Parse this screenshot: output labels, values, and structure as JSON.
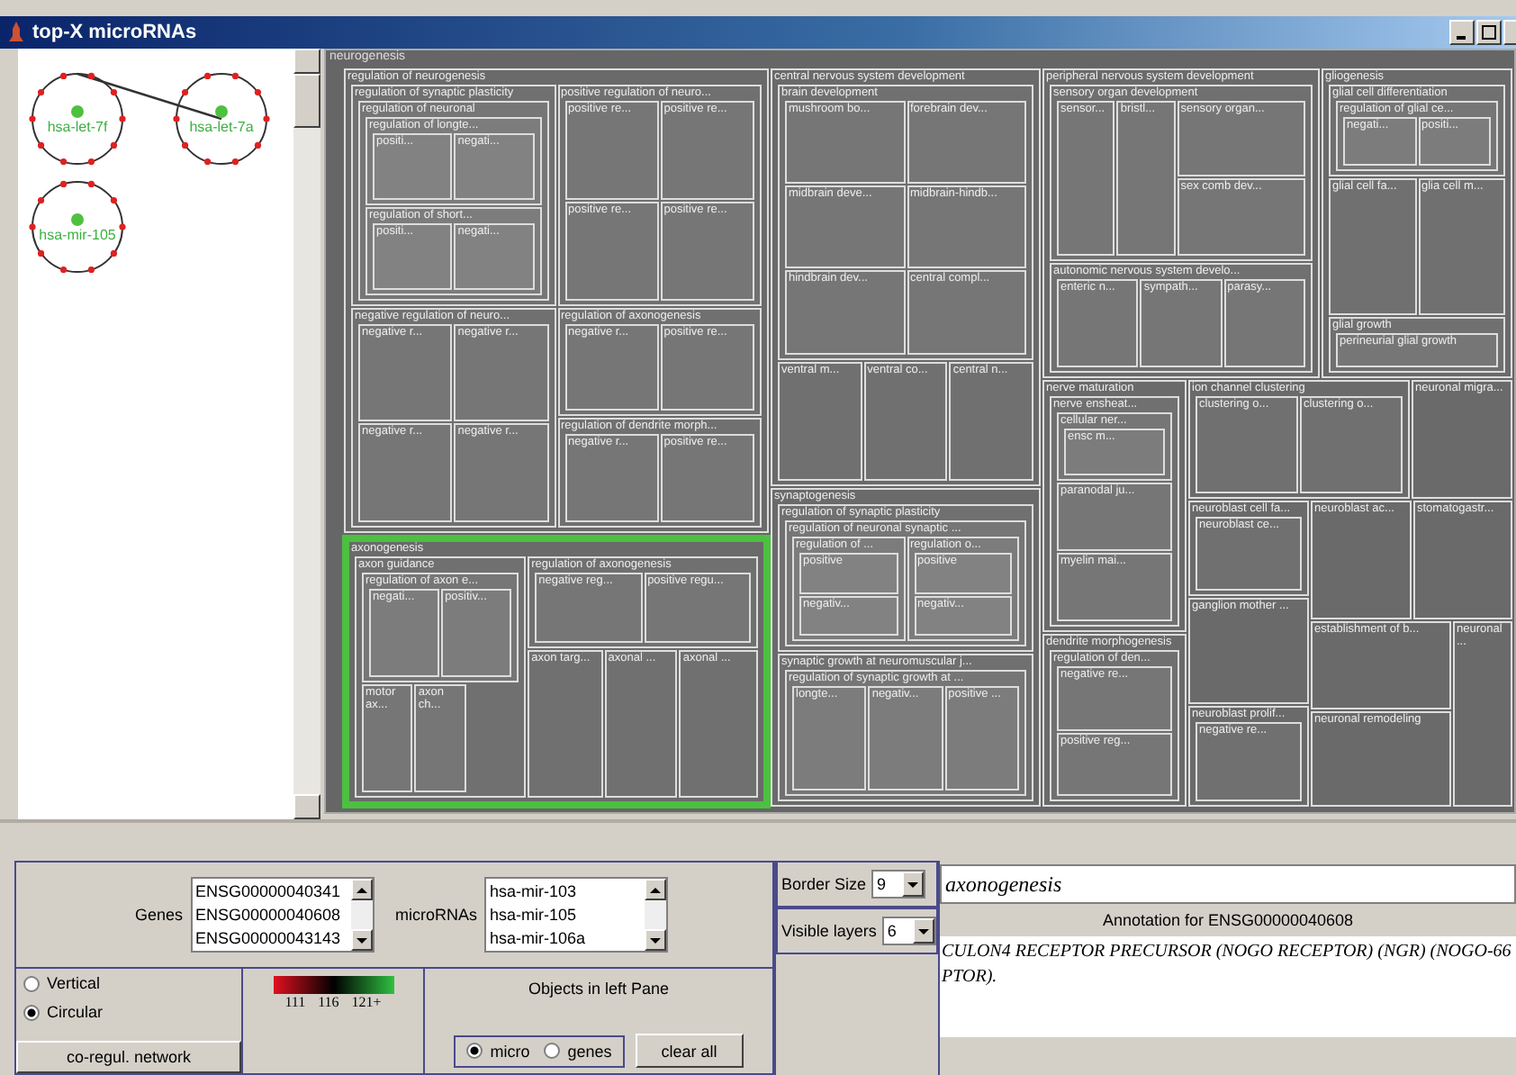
{
  "window": {
    "title": "top-X microRNAs"
  },
  "network": {
    "nodes": [
      {
        "label": "hsa-let-7f"
      },
      {
        "label": "hsa-let-7a"
      },
      {
        "label": "hsa-mir-105"
      }
    ]
  },
  "treemap": {
    "label": "neurogenesis",
    "children": [
      {
        "label": "regulation of neurogenesis",
        "selected": false,
        "children": [
          {
            "label": "regulation of synaptic plasticity",
            "children": [
              {
                "label": "regulation of neuronal",
                "children": [
                  {
                    "label": "regulation of longte...",
                    "children": [
                      {
                        "label": "positi..."
                      },
                      {
                        "label": "negati..."
                      }
                    ]
                  },
                  {
                    "label": "regulation of short...",
                    "children": [
                      {
                        "label": "positi..."
                      },
                      {
                        "label": "negati..."
                      }
                    ]
                  }
                ]
              }
            ]
          },
          {
            "label": "positive regulation of neuro...",
            "children": [
              {
                "label": "positive re..."
              },
              {
                "label": "positive re..."
              },
              {
                "label": "positive re..."
              },
              {
                "label": "positive re..."
              }
            ]
          },
          {
            "label": "negative regulation of neuro...",
            "children": [
              {
                "label": "negative r..."
              },
              {
                "label": "negative r..."
              },
              {
                "label": "negative r..."
              },
              {
                "label": "negative r..."
              }
            ]
          },
          {
            "label": "regulation of axonogenesis",
            "children": [
              {
                "label": "negative r..."
              },
              {
                "label": "positive re..."
              }
            ]
          },
          {
            "label": "regulation of dendrite morph...",
            "children": [
              {
                "label": "negative r..."
              },
              {
                "label": "positive re..."
              }
            ]
          }
        ]
      },
      {
        "label": "central nervous system development",
        "selected": false,
        "children": [
          {
            "label": "brain development",
            "children": [
              {
                "label": "mushroom bo..."
              },
              {
                "label": "forebrain dev..."
              },
              {
                "label": "midbrain deve..."
              },
              {
                "label": "midbrain-hindb..."
              },
              {
                "label": "hindbrain dev..."
              },
              {
                "label": "central compl..."
              }
            ]
          },
          {
            "label": "ventral m..."
          },
          {
            "label": "ventral co..."
          },
          {
            "label": "central n..."
          }
        ]
      },
      {
        "label": "peripheral nervous system development",
        "selected": false,
        "children": [
          {
            "label": "sensory organ development",
            "children": [
              {
                "label": "sensor..."
              },
              {
                "label": "bristl..."
              },
              {
                "label": "sensory organ..."
              },
              {
                "label": "sex comb dev..."
              }
            ]
          },
          {
            "label": "autonomic nervous system develo...",
            "children": [
              {
                "label": "enteric n..."
              },
              {
                "label": "sympath..."
              },
              {
                "label": "parasy..."
              }
            ]
          }
        ]
      },
      {
        "label": "gliogenesis",
        "selected": false,
        "children": [
          {
            "label": "glial cell differentiation",
            "children": [
              {
                "label": "regulation of glial ce...",
                "children": [
                  {
                    "label": "negati..."
                  },
                  {
                    "label": "positi..."
                  }
                ]
              }
            ]
          },
          {
            "label": "glial cell fa..."
          },
          {
            "label": "glia cell m..."
          },
          {
            "label": "glial growth",
            "children": [
              {
                "label": "perineurial glial growth"
              }
            ]
          }
        ]
      },
      {
        "label": "synaptogenesis",
        "selected": false,
        "children": [
          {
            "label": "regulation of synaptic plasticity",
            "children": [
              {
                "label": "regulation of neuronal synaptic ...",
                "children": [
                  {
                    "label": "regulation of ...",
                    "children": [
                      {
                        "label": "positive"
                      },
                      {
                        "label": "negativ..."
                      }
                    ]
                  },
                  {
                    "label": "regulation o...",
                    "children": [
                      {
                        "label": "positive"
                      },
                      {
                        "label": "negativ..."
                      }
                    ]
                  }
                ]
              }
            ]
          },
          {
            "label": "synaptic growth at neuromuscular j...",
            "children": [
              {
                "label": "regulation of synaptic growth at ...",
                "children": [
                  {
                    "label": "longte..."
                  },
                  {
                    "label": "negativ..."
                  },
                  {
                    "label": "positive ..."
                  }
                ]
              }
            ]
          }
        ]
      },
      {
        "label": "axonogenesis",
        "selected": true,
        "children": [
          {
            "label": "axon guidance",
            "children": [
              {
                "label": "regulation of axon e...",
                "children": [
                  {
                    "label": "negati..."
                  },
                  {
                    "label": "positiv..."
                  }
                ]
              },
              {
                "label": "motor ax..."
              },
              {
                "label": "axon ch..."
              }
            ]
          },
          {
            "label": "regulation of axonogenesis",
            "children": [
              {
                "label": "negative reg..."
              },
              {
                "label": "positive regu..."
              }
            ]
          },
          {
            "label": "axon targ..."
          },
          {
            "label": "axonal ..."
          },
          {
            "label": "axonal ..."
          }
        ]
      },
      {
        "label": "nerve maturation",
        "selected": false,
        "children": [
          {
            "label": "nerve ensheat...",
            "children": [
              {
                "label": "cellular ner...",
                "children": [
                  {
                    "label": "ensc m..."
                  }
                ]
              },
              {
                "label": "paranodal ju..."
              },
              {
                "label": "myelin mai..."
              }
            ]
          }
        ]
      },
      {
        "label": "dendrite morphogenesis",
        "selected": false,
        "children": [
          {
            "label": "regulation of den...",
            "children": [
              {
                "label": "negative re..."
              },
              {
                "label": "positive reg..."
              }
            ]
          }
        ]
      },
      {
        "label": "ion channel clustering",
        "selected": false,
        "children": [
          {
            "label": "clustering o..."
          },
          {
            "label": "clustering o..."
          }
        ]
      },
      {
        "label": "neuronal migra...",
        "selected": false
      },
      {
        "label": "neuroblast cell fa...",
        "selected": false,
        "children": [
          {
            "label": "neuroblast ce..."
          }
        ]
      },
      {
        "label": "neuroblast ac...",
        "selected": false
      },
      {
        "label": "stomatogastr...",
        "selected": false
      },
      {
        "label": "ganglion mother ...",
        "selected": false
      },
      {
        "label": "establishment of b...",
        "selected": false
      },
      {
        "label": "neuronal ...",
        "selected": false
      },
      {
        "label": "neuroblast prolif...",
        "selected": false,
        "children": [
          {
            "label": "negative re..."
          }
        ]
      },
      {
        "label": "neuronal remodeling",
        "selected": false
      }
    ]
  },
  "genes": {
    "label": "Genes",
    "items": [
      "ENSG00000040341",
      "ENSG00000040608",
      "ENSG00000043143"
    ]
  },
  "micro_rnas": {
    "label": "microRNAs",
    "items": [
      "hsa-mir-103",
      "hsa-mir-105",
      "hsa-mir-106a"
    ]
  },
  "border_size": {
    "label": "Border Size",
    "value": "9"
  },
  "visible_layers": {
    "label": "Visible layers",
    "value": "6"
  },
  "search": {
    "value": "axonogenesis"
  },
  "annotation": {
    "title": "Annotation for ENSG00000040608",
    "lines": [
      "CULON4 RECEPTOR PRECURSOR (NOGO RECEPTOR) (NGR) (NOGO-66",
      "PTOR)."
    ]
  },
  "layout_options": [
    {
      "label": "Vertical",
      "selected": false
    },
    {
      "label": "Circular",
      "selected": true
    }
  ],
  "network_button": "co-regul. network",
  "legend": {
    "labels": [
      "111",
      "116",
      "121+"
    ]
  },
  "objects": {
    "title": "Objects in left Pane",
    "options": [
      {
        "label": "micro",
        "selected": true
      },
      {
        "label": "genes",
        "selected": false
      }
    ],
    "clear_button": "clear all"
  }
}
